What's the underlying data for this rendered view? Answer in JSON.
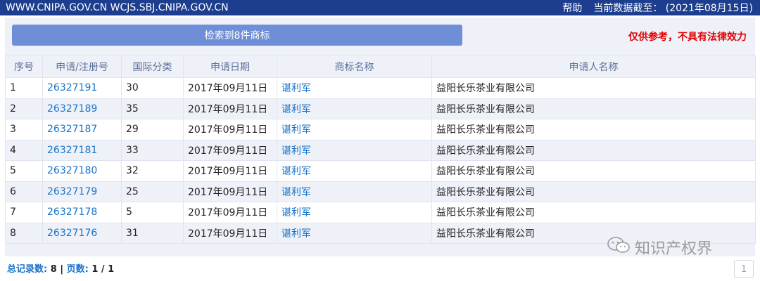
{
  "header": {
    "site": "WWW.CNIPA.GOV.CN WCJS.SBJ.CNIPA.GOV.CN",
    "help": "帮助",
    "data_date": "当前数据截至：  (2021年08月15日)"
  },
  "search": {
    "result_label": "检索到8件商标",
    "disclaimer": "仅供参考，不具有法律效力"
  },
  "table": {
    "headers": [
      "序号",
      "申请/注册号",
      "国际分类",
      "申请日期",
      "商标名称",
      "申请人名称"
    ],
    "rows": [
      [
        "1",
        "26327191",
        "30",
        "2017年09月11日",
        "谌利军",
        "益阳长乐茶业有限公司"
      ],
      [
        "2",
        "26327189",
        "35",
        "2017年09月11日",
        "谌利军",
        "益阳长乐茶业有限公司"
      ],
      [
        "3",
        "26327187",
        "29",
        "2017年09月11日",
        "谌利军",
        "益阳长乐茶业有限公司"
      ],
      [
        "4",
        "26327181",
        "33",
        "2017年09月11日",
        "谌利军",
        "益阳长乐茶业有限公司"
      ],
      [
        "5",
        "26327180",
        "32",
        "2017年09月11日",
        "谌利军",
        "益阳长乐茶业有限公司"
      ],
      [
        "6",
        "26327179",
        "25",
        "2017年09月11日",
        "谌利军",
        "益阳长乐茶业有限公司"
      ],
      [
        "7",
        "26327178",
        "5",
        "2017年09月11日",
        "谌利军",
        "益阳长乐茶业有限公司"
      ],
      [
        "8",
        "26327176",
        "31",
        "2017年09月11日",
        "谌利军",
        "益阳长乐茶业有限公司"
      ]
    ]
  },
  "footer": {
    "total_label": "总记录数:",
    "total_value": "8",
    "sep": "|",
    "pages_label": "页数:",
    "pages_value": "1 / 1",
    "page_button": "1"
  },
  "watermark": {
    "icon": "wechat-icon",
    "text": "知识产权界"
  }
}
